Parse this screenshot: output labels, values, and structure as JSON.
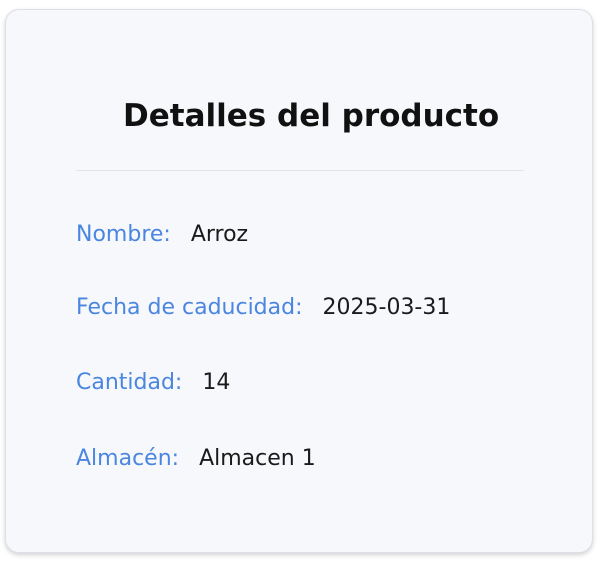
{
  "card": {
    "title": "Detalles del producto",
    "fields": [
      {
        "label": "Nombre:",
        "value": "Arroz"
      },
      {
        "label": "Fecha de caducidad:",
        "value": "2025-03-31"
      },
      {
        "label": "Cantidad:",
        "value": "14"
      },
      {
        "label": "Almacén:",
        "value": "Almacen 1"
      }
    ]
  },
  "colors": {
    "label": "#4a86e0",
    "value": "#1a1a1a",
    "title": "#111111",
    "card_background": "#f7f8fb"
  }
}
